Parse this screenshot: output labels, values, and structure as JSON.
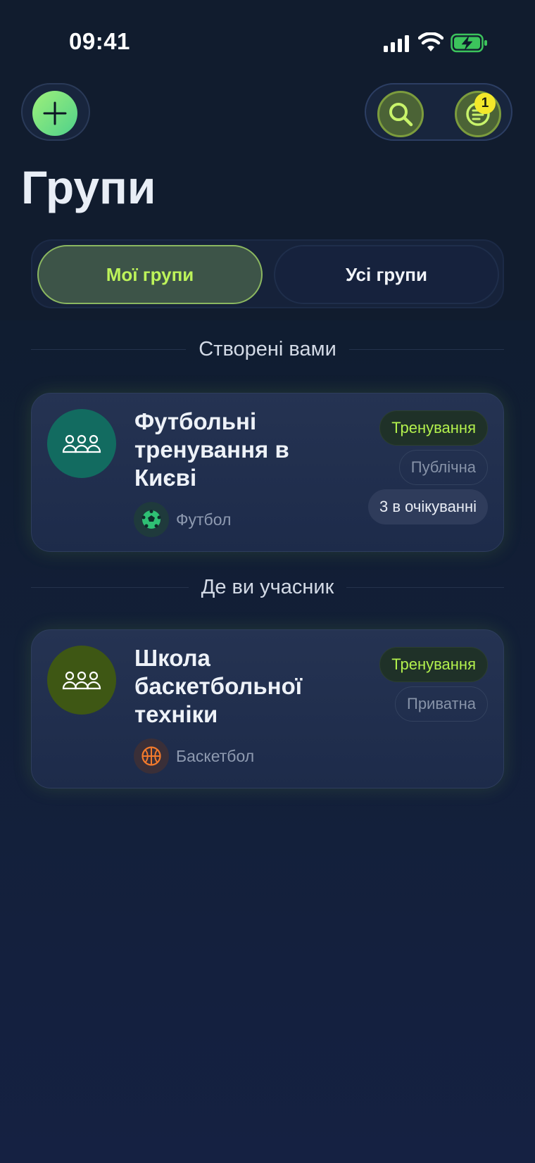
{
  "status_bar": {
    "time": "09:41"
  },
  "header": {
    "title": "Групи",
    "notification_count": "1",
    "icons": [
      "plus-icon",
      "search-icon",
      "notifications-icon"
    ]
  },
  "tabs": {
    "my_groups": "Мої групи",
    "all_groups": "Усі групи",
    "active": "my_groups"
  },
  "sections": {
    "created": "Створені вами",
    "member": "Де ви учасник"
  },
  "groups": [
    {
      "title": "Футбольні тренування в Києві",
      "sport": "Футбол",
      "type_tag": "Тренування",
      "visibility_tag": "Публічна",
      "pending_tag": "3 в очікуванні",
      "avatar_color": "#126b60"
    },
    {
      "title": "Школа баскетбольної техніки",
      "sport": "Баскетбол",
      "type_tag": "Тренування",
      "visibility_tag": "Приватна",
      "avatar_color": "#3e5714"
    }
  ],
  "colors": {
    "accent": "#b3f14d",
    "background": "#111c2e",
    "badge": "#f3e82a"
  }
}
